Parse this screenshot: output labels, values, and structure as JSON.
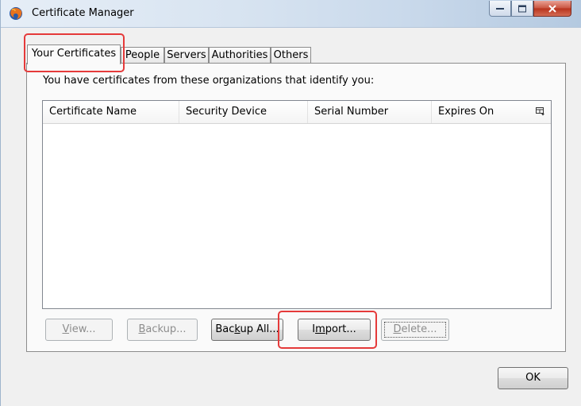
{
  "window": {
    "title": "Certificate Manager",
    "icon": "firefox-icon"
  },
  "tabs": [
    {
      "label": "Your Certificates",
      "active": true
    },
    {
      "label": "People",
      "active": false
    },
    {
      "label": "Servers",
      "active": false
    },
    {
      "label": "Authorities",
      "active": false
    },
    {
      "label": "Others",
      "active": false
    }
  ],
  "panel": {
    "description": "You have certificates from these organizations that identify you:"
  },
  "table": {
    "columns": [
      "Certificate Name",
      "Security Device",
      "Serial Number",
      "Expires On"
    ],
    "rows": []
  },
  "buttons": {
    "view": {
      "pre": "",
      "key": "V",
      "post": "iew...",
      "enabled": false
    },
    "backup": {
      "pre": "",
      "key": "B",
      "post": "ackup...",
      "enabled": false
    },
    "backup_all": {
      "pre": "Bac",
      "key": "k",
      "post": "up All...",
      "enabled": true
    },
    "import": {
      "pre": "I",
      "key": "m",
      "post": "port...",
      "enabled": true
    },
    "delete": {
      "pre": "",
      "key": "D",
      "post": "elete...",
      "enabled": false
    },
    "ok": {
      "label": "OK"
    }
  },
  "colors": {
    "highlight": "#e53a3a",
    "title_gradient_end": "#b4c9e0",
    "close_button": "#c9533f"
  }
}
